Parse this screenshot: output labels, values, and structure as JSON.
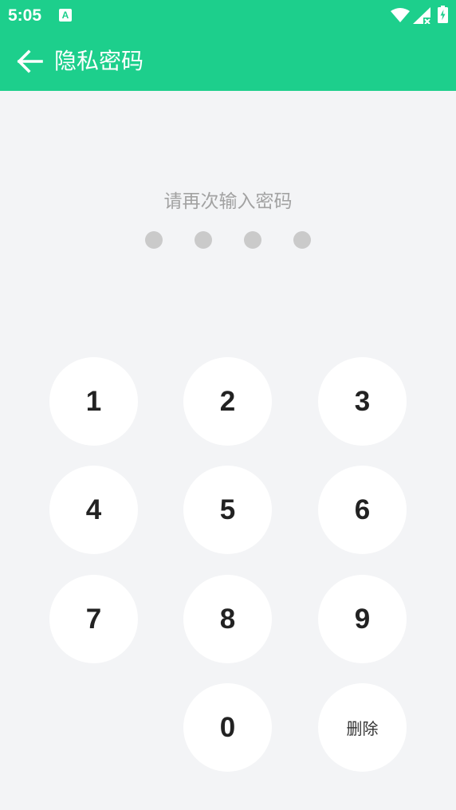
{
  "status_bar": {
    "time": "5:05",
    "app_icon_letter": "A",
    "icons": [
      "wifi-icon",
      "signal-icon",
      "battery-icon"
    ]
  },
  "app_bar": {
    "title": "隐私密码",
    "back_icon": "arrow-left-icon",
    "color": "#1dcf8c"
  },
  "prompt": "请再次输入密码",
  "password": {
    "length": 4,
    "entered": 0
  },
  "keypad": {
    "k1": "1",
    "k2": "2",
    "k3": "3",
    "k4": "4",
    "k5": "5",
    "k6": "6",
    "k7": "7",
    "k8": "8",
    "k9": "9",
    "k0": "0",
    "delete": "删除"
  },
  "colors": {
    "accent": "#1dcf8c",
    "background": "#f3f4f6",
    "dot": "#cacaca",
    "prompt_text": "#a2a2a2"
  }
}
